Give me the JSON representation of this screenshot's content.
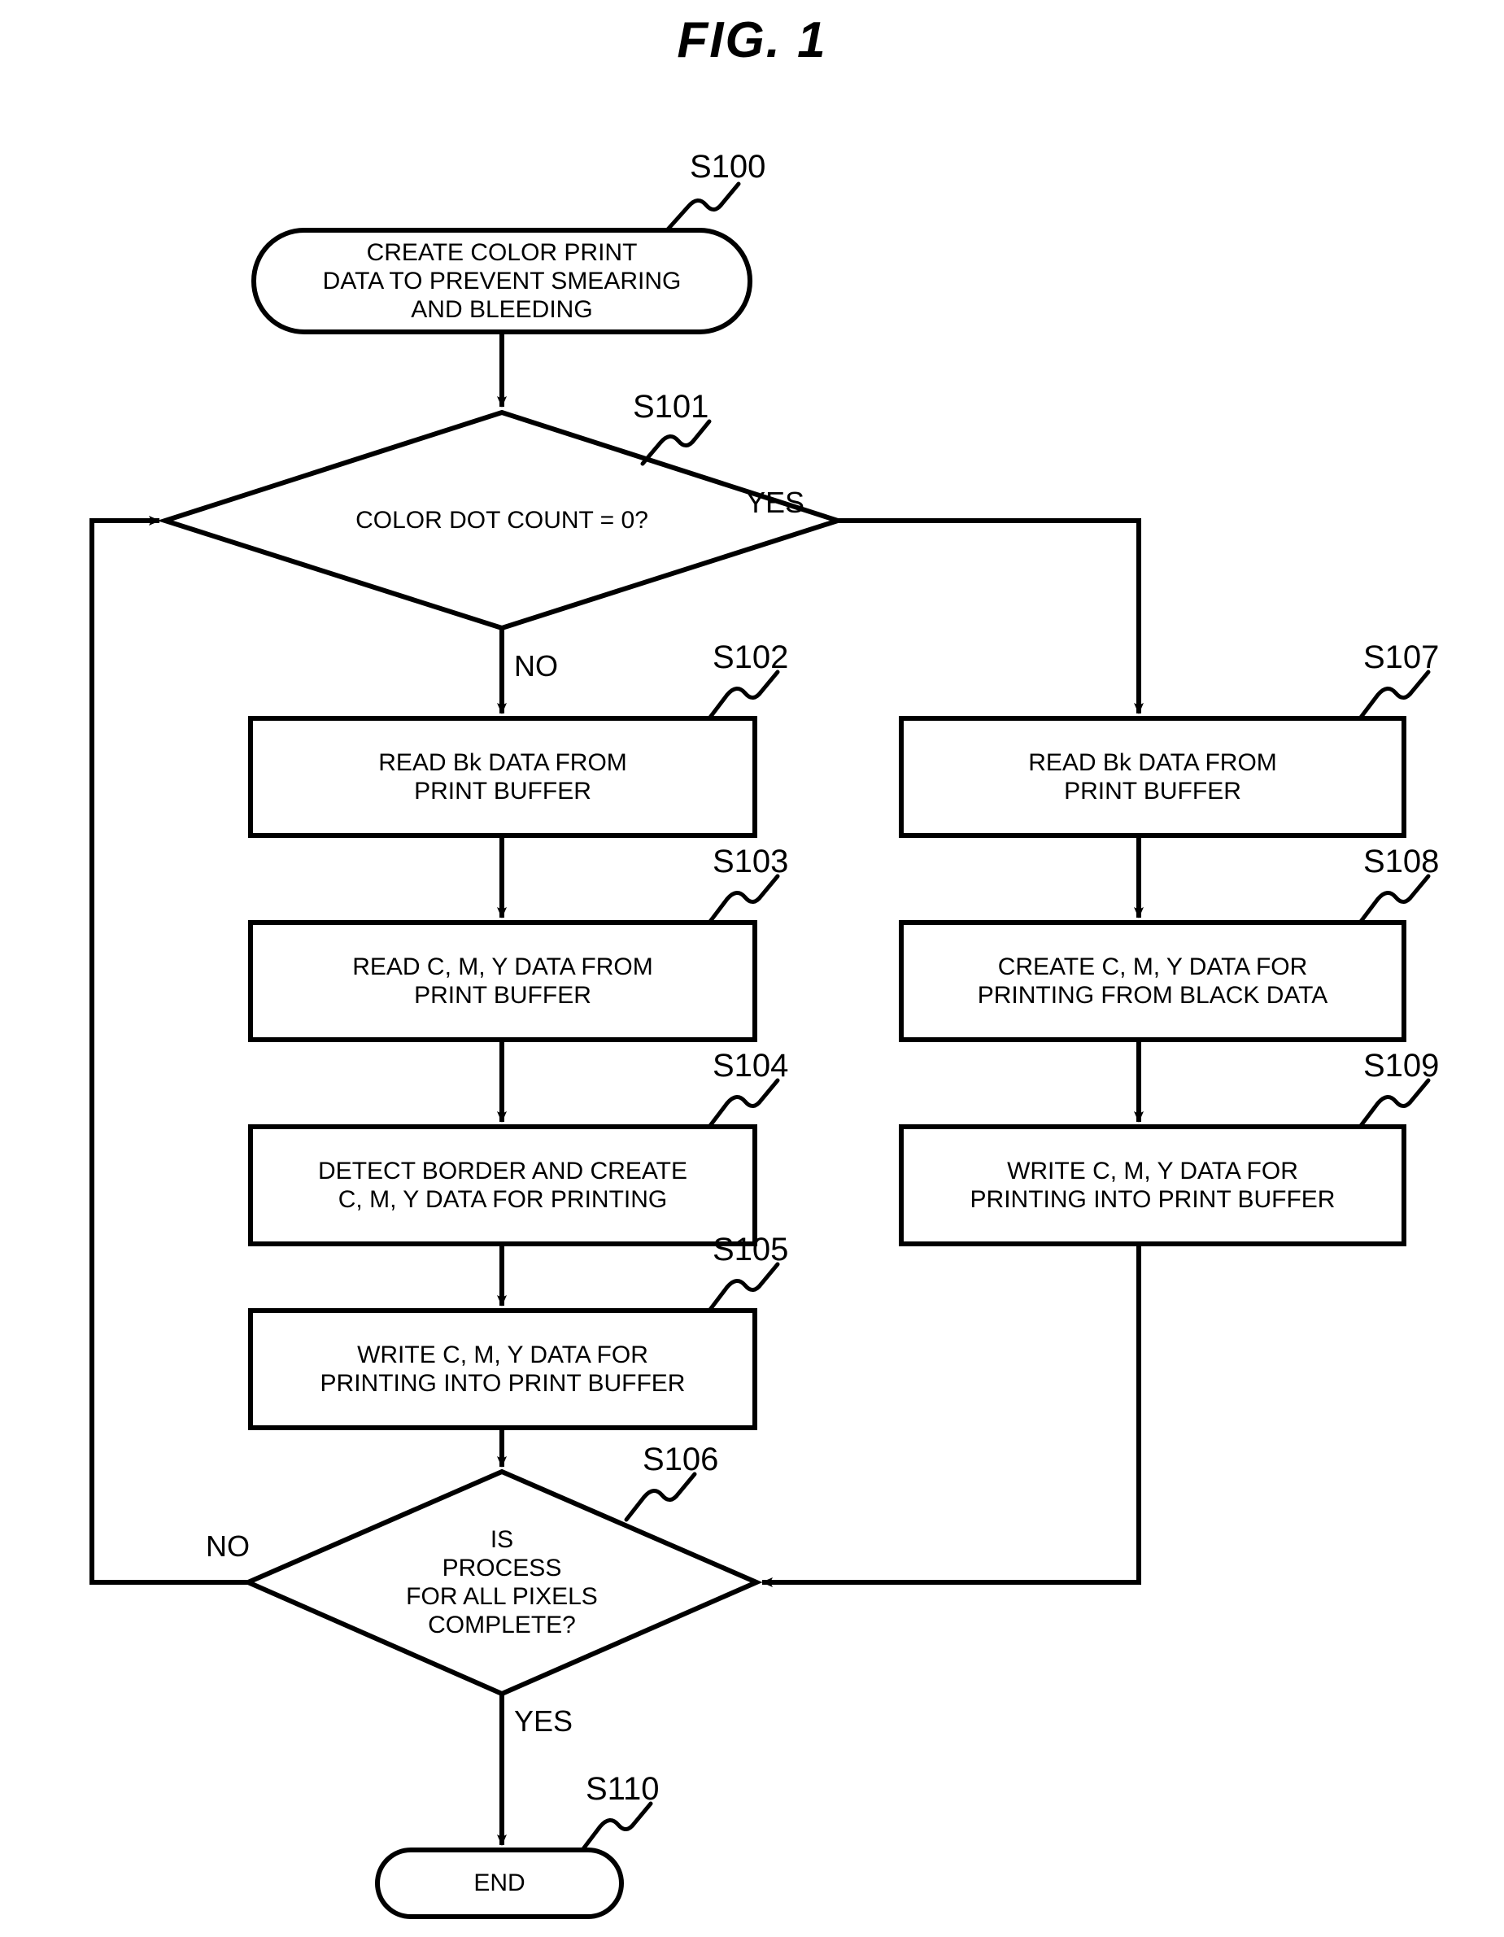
{
  "figure": {
    "title": "FIG.  1"
  },
  "nodes": [
    {
      "id": "S100",
      "shape": "terminator",
      "text": "CREATE COLOR PRINT\nDATA TO PREVENT SMEARING\nAND BLEEDING"
    },
    {
      "id": "S101",
      "shape": "decision",
      "text": "COLOR DOT COUNT = 0?"
    },
    {
      "id": "S102",
      "shape": "process",
      "text": "READ Bk DATA FROM\nPRINT BUFFER"
    },
    {
      "id": "S103",
      "shape": "process",
      "text": "READ C, M, Y DATA FROM\nPRINT BUFFER"
    },
    {
      "id": "S104",
      "shape": "process",
      "text": "DETECT BORDER AND CREATE\nC, M, Y DATA FOR PRINTING"
    },
    {
      "id": "S105",
      "shape": "process",
      "text": "WRITE C, M, Y DATA FOR\nPRINTING INTO PRINT BUFFER"
    },
    {
      "id": "S106",
      "shape": "decision",
      "text": "IS\nPROCESS\nFOR ALL PIXELS\nCOMPLETE?"
    },
    {
      "id": "S107",
      "shape": "process",
      "text": "READ Bk DATA FROM\nPRINT BUFFER"
    },
    {
      "id": "S108",
      "shape": "process",
      "text": "CREATE C, M, Y DATA FOR\nPRINTING FROM BLACK DATA"
    },
    {
      "id": "S109",
      "shape": "process",
      "text": "WRITE C, M, Y DATA FOR\nPRINTING INTO PRINT BUFFER"
    },
    {
      "id": "S110",
      "shape": "terminator",
      "text": "END"
    }
  ],
  "edge_labels": {
    "s101_yes": "YES",
    "s101_no": "NO",
    "s106_no": "NO",
    "s106_yes": "YES"
  },
  "colors": {
    "stroke": "#000000",
    "background": "#ffffff",
    "text": "#000000"
  }
}
